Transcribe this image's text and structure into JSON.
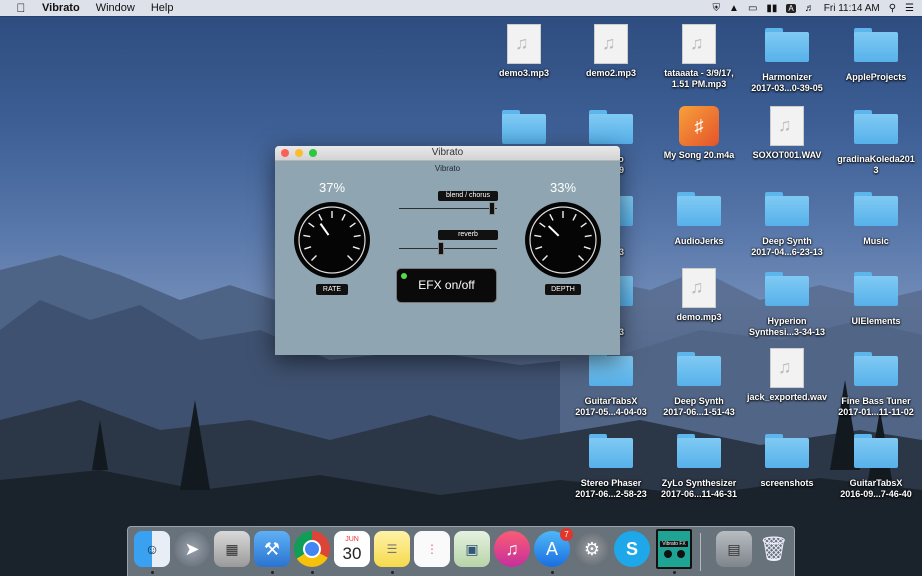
{
  "menubar": {
    "app_name": "Vibrato",
    "items": [
      "Window",
      "Help"
    ],
    "clock": "Fri 11:14 AM",
    "input_badge": "A"
  },
  "desktop_icons": [
    {
      "label": "demo3.mp3",
      "kind": "audio"
    },
    {
      "label": "demo2.mp3",
      "kind": "audio"
    },
    {
      "label": "tataaata - 3/9/17,\n1.51 PM.mp3",
      "kind": "audio"
    },
    {
      "label": "Harmonizer\n2017-03...0-39-05",
      "kind": "folder"
    },
    {
      "label": "AppleProjects",
      "kind": "folder"
    },
    {
      "label": "",
      "kind": "folder"
    },
    {
      "label": "Audio\n-42-29",
      "kind": "folder"
    },
    {
      "label": "My Song 20.m4a",
      "kind": "garageband"
    },
    {
      "label": "SOXOT001.WAV",
      "kind": "audio"
    },
    {
      "label": "gradinaKoleda201\n3",
      "kind": "folder"
    },
    {
      "label": "ox\n-42-53",
      "kind": "folder"
    },
    {
      "label": "AudioJerks",
      "kind": "folder"
    },
    {
      "label": "Deep Synth\n2017-04...6-23-13",
      "kind": "folder"
    },
    {
      "label": "Music",
      "kind": "folder"
    },
    {
      "label": "nth\n-36-33",
      "kind": "folder"
    },
    {
      "label": "demo.mp3",
      "kind": "audio"
    },
    {
      "label": "Hyperion\nSynthesi...3-34-13",
      "kind": "folder"
    },
    {
      "label": "UIElements",
      "kind": "folder"
    },
    {
      "label": "GuitarTabsX\n2017-05...4-04-03",
      "kind": "folder"
    },
    {
      "label": "Deep Synth\n2017-06...1-51-43",
      "kind": "folder"
    },
    {
      "label": "jack_exported.wav",
      "kind": "audio"
    },
    {
      "label": "Fine Bass Tuner\n2017-01...11-11-02",
      "kind": "folder"
    },
    {
      "label": "Stereo Phaser\n2017-06...2-58-23",
      "kind": "folder"
    },
    {
      "label": "ZyLo Synthesizer\n2017-06...11-46-31",
      "kind": "folder"
    },
    {
      "label": "screenshots",
      "kind": "folder"
    },
    {
      "label": "GuitarTabsX\n2016-09...7-46-40",
      "kind": "folder"
    }
  ],
  "window": {
    "title": "Vibrato",
    "subtitle": "Vibrato",
    "rate": {
      "value": "37%",
      "label": "RATE",
      "fraction": 0.37
    },
    "depth": {
      "value": "33%",
      "label": "DEPTH",
      "fraction": 0.33
    },
    "blend": {
      "label": "blend / chorus",
      "fraction": 0.98
    },
    "reverb": {
      "label": "reverb",
      "fraction": 0.42
    },
    "efx_button": {
      "label": "EFX on/off",
      "on": true
    },
    "colors": {
      "panel": "#8fa6b2",
      "led": "#4fe04a"
    }
  },
  "dock": {
    "calendar_month": "JUN",
    "calendar_day": "30",
    "appstore_badge": "7",
    "vibrato_icon_text": "Vibrato FX"
  }
}
